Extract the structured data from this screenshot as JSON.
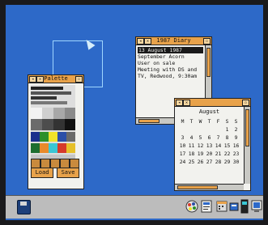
{
  "palette": {
    "title": "Palette",
    "load_label": "Load",
    "save_label": "Save"
  },
  "diary": {
    "title": "1987 Diary",
    "date_line": "13  August   1987",
    "lines": [
      "September Acorn",
      "User on sale",
      "",
      "Meeting with DS and",
      "TV, Redwood, 9:30am"
    ]
  },
  "calendar": {
    "month": "August",
    "weekdays": [
      "M",
      "T",
      "W",
      "T",
      "F",
      "S",
      "S"
    ],
    "weeks": [
      [
        "",
        "",
        "",
        "",
        "",
        "1",
        "2"
      ],
      [
        "3",
        "4",
        "5",
        "6",
        "7",
        "8",
        "9"
      ],
      [
        "10",
        "11",
        "12",
        "13",
        "14",
        "15",
        "16"
      ],
      [
        "17",
        "18",
        "19",
        "20",
        "21",
        "22",
        "23"
      ],
      [
        "24",
        "25",
        "26",
        "27",
        "28",
        "29",
        "30"
      ]
    ]
  },
  "colors": {
    "desktop": "#2d69c8",
    "titlebar": "#e8a24a",
    "iconbar": "#bcbcbc"
  },
  "icons": {
    "iconbar_left": "disc-drive-icon",
    "iconbar_right": [
      "palette-icon",
      "application-icon",
      "calendar-icon",
      "diary-icon",
      "task-manager-icon"
    ]
  }
}
